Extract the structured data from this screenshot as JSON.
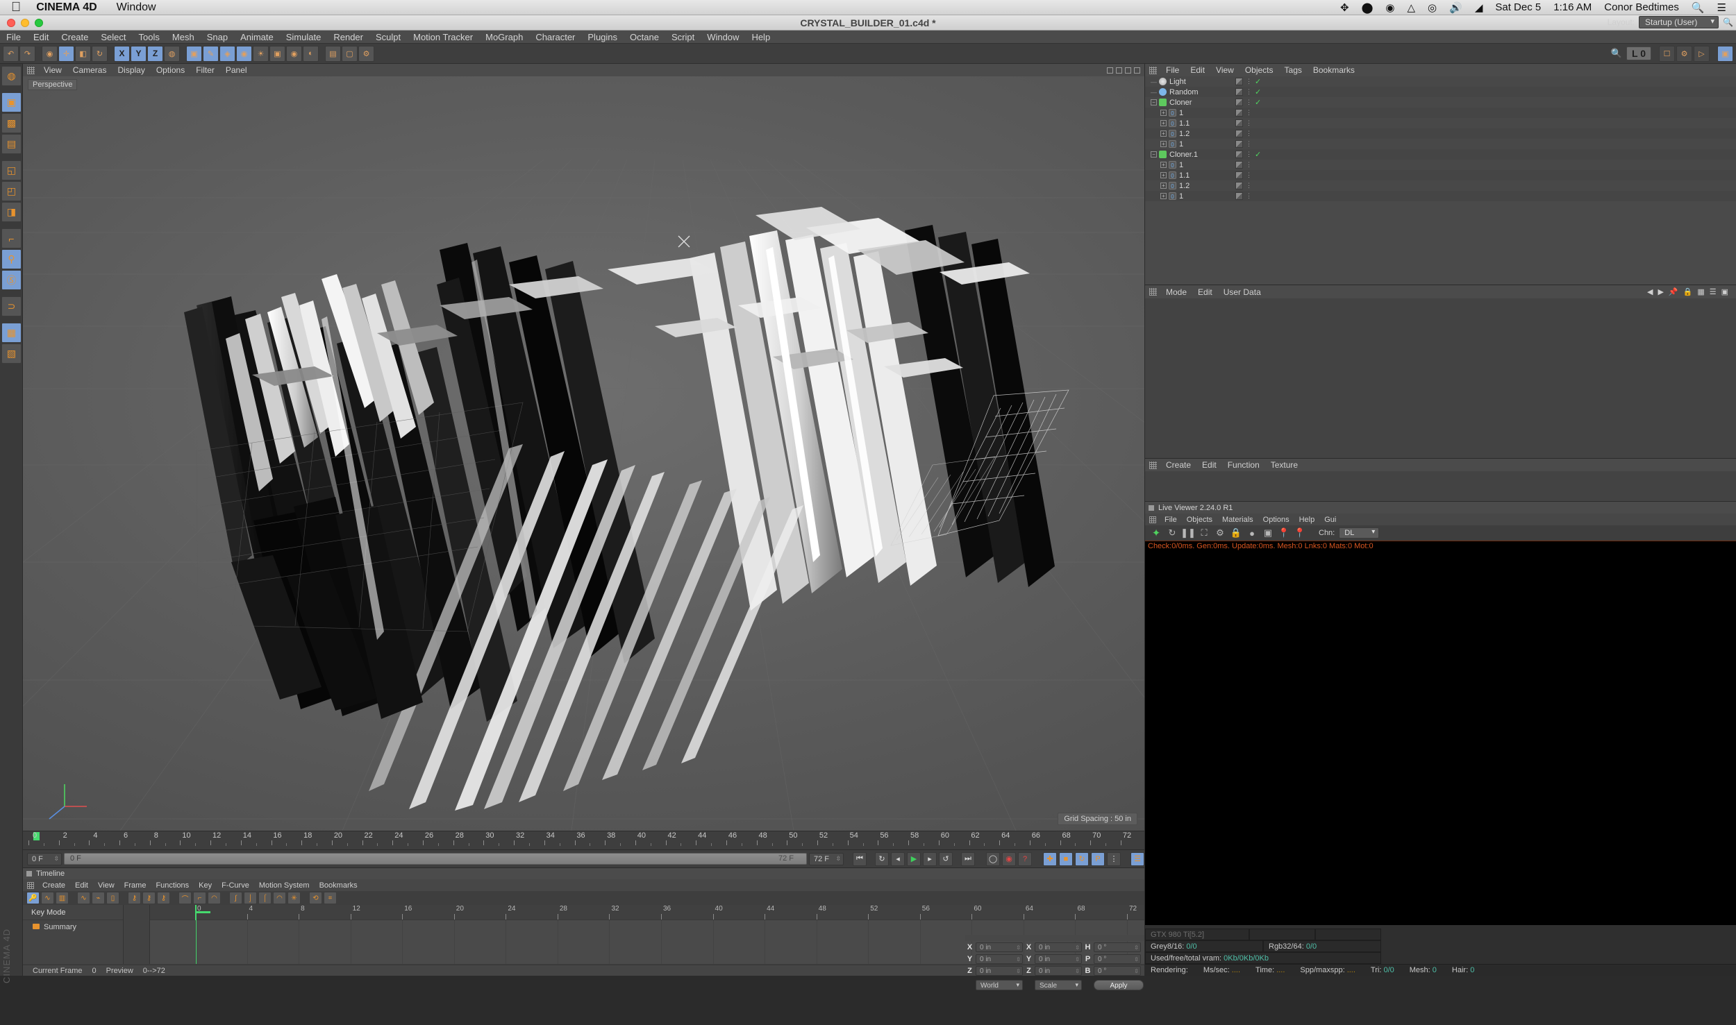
{
  "macos": {
    "apple_glyph": "",
    "app_name": "CINEMA 4D",
    "window_menu": "Window",
    "status_icons": [
      "dropbox-icon",
      "droplet-icon",
      "creative-cloud-icon",
      "google-drive-icon",
      "nvidia-icon",
      "volume-icon",
      "wifi-icon"
    ],
    "date": "Sat Dec 5",
    "time": "1:16 AM",
    "user": "Conor Bedtimes",
    "search_icon": "search-icon",
    "notification_icon": "notification-center-icon"
  },
  "window": {
    "title": "CRYSTAL_BUILDER_01.c4d *"
  },
  "menubar": {
    "items": [
      "File",
      "Edit",
      "Create",
      "Select",
      "Tools",
      "Mesh",
      "Snap",
      "Animate",
      "Simulate",
      "Render",
      "Sculpt",
      "Motion Tracker",
      "MoGraph",
      "Character",
      "Plugins",
      "Octane",
      "Script",
      "Window",
      "Help"
    ]
  },
  "layout": {
    "label": "Layout:",
    "value": "Startup (User)"
  },
  "toolbar": {
    "axis_x": "X",
    "axis_y": "Y",
    "axis_z": "Z",
    "layer_badge": "L 0"
  },
  "viewport": {
    "menus": [
      "View",
      "Cameras",
      "Display",
      "Options",
      "Filter",
      "Panel"
    ],
    "label": "Perspective",
    "grid_spacing": "Grid Spacing : 50 in"
  },
  "object_manager": {
    "menus": [
      "File",
      "Edit",
      "View",
      "Objects",
      "Tags",
      "Bookmarks"
    ],
    "objects": [
      {
        "name": "Light",
        "depth": 0,
        "icon": "light-icon",
        "expandable": false,
        "check": true
      },
      {
        "name": "Random",
        "depth": 0,
        "icon": "random-effector-icon",
        "expandable": false,
        "check": true
      },
      {
        "name": "Cloner",
        "depth": 0,
        "icon": "cloner-icon",
        "expandable": true,
        "expanded": true,
        "check": true
      },
      {
        "name": "1",
        "depth": 1,
        "icon": "null-object-icon",
        "expandable": true,
        "expanded": false,
        "check": false
      },
      {
        "name": "1.1",
        "depth": 1,
        "icon": "null-object-icon",
        "expandable": true,
        "expanded": false,
        "check": false
      },
      {
        "name": "1.2",
        "depth": 1,
        "icon": "null-object-icon",
        "expandable": true,
        "expanded": false,
        "check": false
      },
      {
        "name": "1",
        "depth": 1,
        "icon": "null-object-icon",
        "expandable": true,
        "expanded": false,
        "check": false
      },
      {
        "name": "Cloner.1",
        "depth": 0,
        "icon": "cloner-icon",
        "expandable": true,
        "expanded": true,
        "check": true
      },
      {
        "name": "1",
        "depth": 1,
        "icon": "null-object-icon",
        "expandable": true,
        "expanded": false,
        "check": false
      },
      {
        "name": "1.1",
        "depth": 1,
        "icon": "null-object-icon",
        "expandable": true,
        "expanded": false,
        "check": false
      },
      {
        "name": "1.2",
        "depth": 1,
        "icon": "null-object-icon",
        "expandable": true,
        "expanded": false,
        "check": false
      },
      {
        "name": "1",
        "depth": 1,
        "icon": "null-object-icon",
        "expandable": true,
        "expanded": false,
        "check": false
      }
    ]
  },
  "attribute_manager": {
    "menus": [
      "Mode",
      "Edit",
      "User Data"
    ]
  },
  "material_manager": {
    "menus": [
      "Create",
      "Edit",
      "Function",
      "Texture"
    ]
  },
  "live_viewer": {
    "title": "Live Viewer 2.24.0 R1",
    "menus": [
      "File",
      "Objects",
      "Materials",
      "Options",
      "Help",
      "Gui"
    ],
    "channel_label": "Chn:",
    "channel_value": "DL",
    "status": "Check:0/0ms. Gen:0ms. Update:0ms. Mesh:0 Lnks:0 Mats:0 Mot:0",
    "gpu": "GTX 980 Ti[5.2]",
    "grey_label": "Grey8/16:",
    "grey_value": "0/0",
    "rgb_label": "Rgb32/64:",
    "rgb_value": "0/0",
    "vram_label": "Used/free/total vram:",
    "vram_value": "0Kb/0Kb/0Kb",
    "render_label": "Rendering:",
    "mssec_label": "Ms/sec:",
    "mssec_value": "....",
    "time_label": "Time:",
    "time_value": "....",
    "spp_label": "Spp/maxspp:",
    "spp_value": "....",
    "tri_label": "Tri:",
    "tri_value": "0/0",
    "mesh_label": "Mesh:",
    "mesh_value": "0",
    "hair_label": "Hair:",
    "hair_value": "0"
  },
  "timeline_strip": {
    "ticks": [
      0,
      2,
      4,
      6,
      8,
      10,
      12,
      14,
      16,
      18,
      20,
      22,
      24,
      26,
      28,
      30,
      32,
      34,
      36,
      38,
      40,
      42,
      44,
      46,
      48,
      50,
      52,
      54,
      56,
      58,
      60,
      62,
      64,
      66,
      68,
      70,
      72
    ],
    "current_frame_field": "0 F",
    "slider_left": "0 F",
    "slider_right": "72 F",
    "end_frame_field": "72 F",
    "right_frame_field": "0 F"
  },
  "timeline_panel": {
    "title": "Timeline",
    "menus": [
      "Create",
      "Edit",
      "View",
      "Frame",
      "Functions",
      "Key",
      "F-Curve",
      "Motion System",
      "Bookmarks"
    ],
    "key_mode": "Key Mode",
    "summary": "Summary",
    "ruler_ticks": [
      0,
      4,
      8,
      12,
      16,
      20,
      24,
      28,
      32,
      36,
      40,
      44,
      48,
      52,
      56,
      60,
      64,
      68,
      72
    ],
    "status_current_frame_label": "Current Frame",
    "status_current_frame_value": "0",
    "status_preview_label": "Preview",
    "status_preview_value": "0-->72",
    "watermark": "CINEMA 4D"
  },
  "coordinates": {
    "position": [
      {
        "label": "X",
        "value": "0 in"
      },
      {
        "label": "Y",
        "value": "0 in"
      },
      {
        "label": "Z",
        "value": "0 in"
      }
    ],
    "size": [
      {
        "label": "X",
        "value": "0 in"
      },
      {
        "label": "Y",
        "value": "0 in"
      },
      {
        "label": "Z",
        "value": "0 in"
      }
    ],
    "rotation": [
      {
        "label": "H",
        "value": "0 °"
      },
      {
        "label": "P",
        "value": "0 °"
      },
      {
        "label": "B",
        "value": "0 °"
      }
    ],
    "coord_system": "World",
    "mode": "Scale",
    "apply": "Apply"
  },
  "colors": {
    "accent_orange": "#e8932e",
    "selection_blue": "#7a9fd4",
    "green_check": "#4fd35f",
    "panel_bg": "#3e3e3e",
    "status_orange": "#d9551f",
    "teal_value": "#4fbfa8"
  }
}
